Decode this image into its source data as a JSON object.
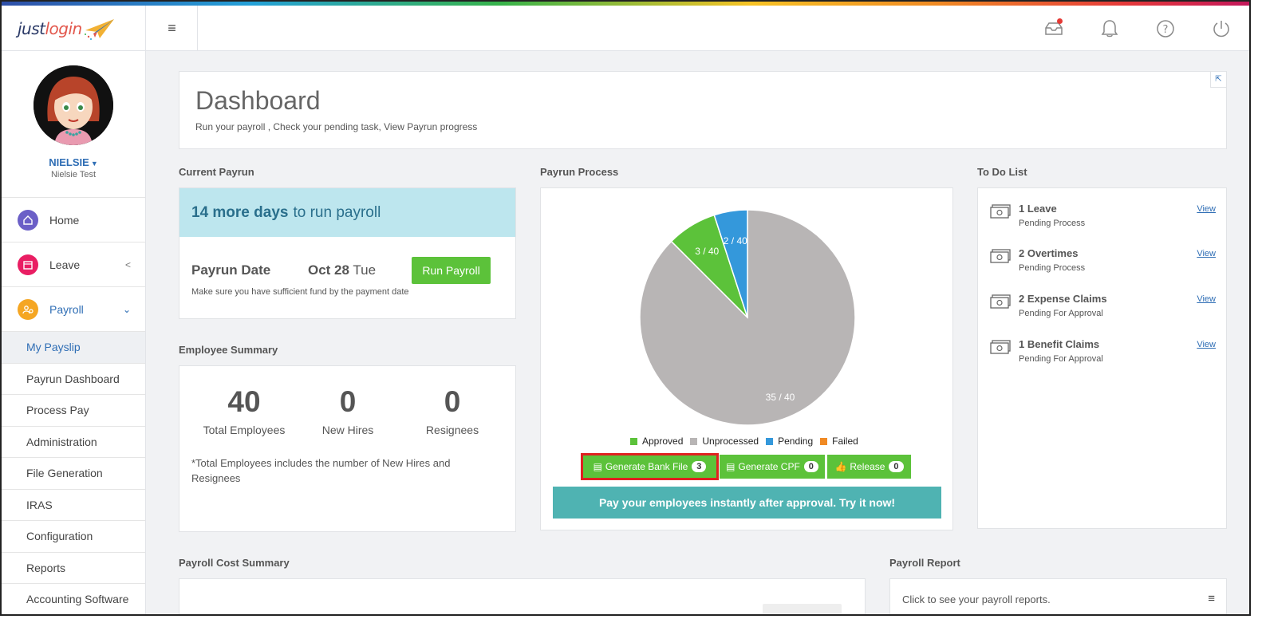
{
  "app": {
    "logo_just": "just",
    "logo_login": "login",
    "menu_toggle": "≡"
  },
  "user": {
    "name": "NIELSIE",
    "fullname": "Nielsie Test"
  },
  "sidebar": {
    "items": [
      {
        "label": "Home",
        "color": "#6b5fc7"
      },
      {
        "label": "Leave",
        "color": "#e91e63"
      },
      {
        "label": "Payroll",
        "color": "#f5a623"
      }
    ],
    "payroll_sub": [
      "My Payslip",
      "Payrun Dashboard",
      "Process Pay",
      "Administration",
      "File Generation",
      "IRAS",
      "Configuration",
      "Reports",
      "Accounting Software"
    ]
  },
  "header": {
    "title": "Dashboard",
    "subtitle": "Run your payroll , Check your pending task, View Payrun progress"
  },
  "current_payrun": {
    "section": "Current Payrun",
    "days_bold": "14 more days",
    "days_rest": "to run payroll",
    "date_label": "Payrun Date",
    "date_value": "Oct 28",
    "date_day": "Tue",
    "run_button": "Run Payroll",
    "note": "Make sure you have sufficient fund by the payment date"
  },
  "employee_summary": {
    "section": "Employee Summary",
    "stats": [
      {
        "value": "40",
        "label": "Total Employees"
      },
      {
        "value": "0",
        "label": "New Hires"
      },
      {
        "value": "0",
        "label": "Resignees"
      }
    ],
    "note": "*Total Employees includes the number of New Hires and Resignees"
  },
  "payrun_process": {
    "section": "Payrun Process",
    "legend": [
      {
        "label": "Approved",
        "color": "#5cc23a"
      },
      {
        "label": "Unprocessed",
        "color": "#b8b5b5"
      },
      {
        "label": "Pending",
        "color": "#3498db"
      },
      {
        "label": "Failed",
        "color": "#f08a24"
      }
    ],
    "buttons": [
      {
        "label": "Generate Bank File",
        "count": "3"
      },
      {
        "label": "Generate CPF",
        "count": "0"
      },
      {
        "label": "Release",
        "count": "0"
      }
    ],
    "banner": "Pay your employees instantly after approval. Try it now!"
  },
  "chart_data": {
    "type": "pie",
    "categories": [
      "Unprocessed",
      "Approved",
      "Pending",
      "Failed"
    ],
    "values": [
      35,
      3,
      2,
      0
    ],
    "total": 40,
    "labels": [
      "35 / 40",
      "3 / 40",
      "2 / 40",
      ""
    ],
    "colors": [
      "#b8b5b5",
      "#5cc23a",
      "#3498db",
      "#f08a24"
    ],
    "legend_position": "bottom"
  },
  "todo": {
    "section": "To Do List",
    "items": [
      {
        "title": "1 Leave",
        "status": "Pending Process",
        "link": "View"
      },
      {
        "title": "2 Overtimes",
        "status": "Pending Process",
        "link": "View"
      },
      {
        "title": "2 Expense Claims",
        "status": "Pending For Approval",
        "link": "View"
      },
      {
        "title": "1 Benefit Claims",
        "status": "Pending For Approval",
        "link": "View"
      }
    ]
  },
  "payroll_cost": {
    "section": "Payroll Cost Summary"
  },
  "payroll_report": {
    "section": "Payroll Report",
    "text": "Click to see your payroll reports."
  }
}
